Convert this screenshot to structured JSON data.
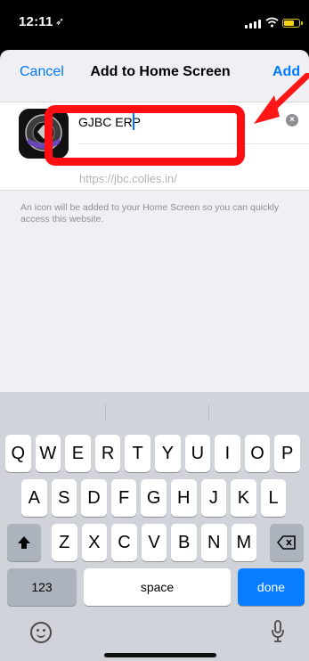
{
  "status_bar": {
    "time": "12:11"
  },
  "dialog": {
    "title": "Add to Home Screen",
    "cancel_label": "Cancel",
    "add_label": "Add",
    "app_name_value": "GJBC ERP",
    "url": "https://jbc.colles.in/",
    "note": "An icon will be added to your Home Screen so you can quickly access this website."
  },
  "keyboard": {
    "row1": [
      "Q",
      "W",
      "E",
      "R",
      "T",
      "Y",
      "U",
      "I",
      "O",
      "P"
    ],
    "row2": [
      "A",
      "S",
      "D",
      "F",
      "G",
      "H",
      "J",
      "K",
      "L"
    ],
    "row3": [
      "Z",
      "X",
      "C",
      "V",
      "B",
      "N",
      "M"
    ],
    "numbers_label": "123",
    "space_label": "space",
    "done_label": "done"
  },
  "colors": {
    "accent": "#007aff",
    "highlight": "#ff0f14",
    "done": "#0a7cff"
  }
}
